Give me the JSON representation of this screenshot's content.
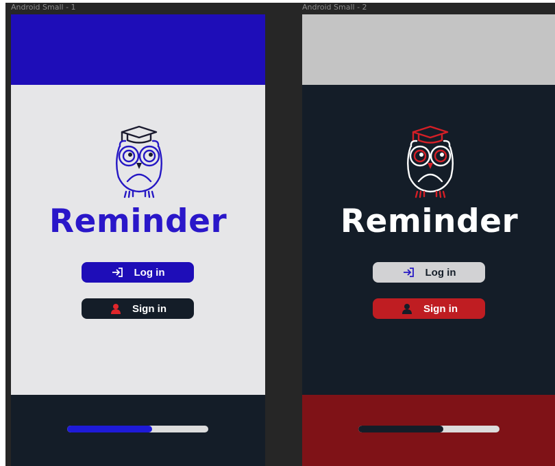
{
  "frames": [
    {
      "label": "Android Small - 1",
      "title": "Reminder",
      "login_label": "Log in",
      "signin_label": "Sign in",
      "progress": 0.6,
      "colors": {
        "top_bar": "#1e0db8",
        "body": "#e6e6e8",
        "bottom_bar": "#141d28",
        "title": "#2a17c9",
        "owl_primary": "#2517c4",
        "owl_accent": "#1a1a2e",
        "login_bg": "#1e0db8",
        "login_text": "#ffffff",
        "signin_bg": "#141d28",
        "signin_text": "#ffffff",
        "signin_icon": "#e0262b",
        "progress_fill": "#1e1ad8",
        "progress_track": "#dcdcdc"
      }
    },
    {
      "label": "Android Small - 2",
      "title": "Reminder",
      "login_label": "Log in",
      "signin_label": "Sign in",
      "progress": 0.6,
      "colors": {
        "top_bar": "#c4c4c4",
        "body": "#141d28",
        "bottom_bar": "#7f1217",
        "title": "#ffffff",
        "owl_primary": "#ffffff",
        "owl_accent": "#d51f26",
        "login_bg": "#d2d2d4",
        "login_text": "#141d28",
        "signin_bg": "#bf1d22",
        "signin_text": "#ffffff",
        "signin_icon": "#141d28",
        "progress_fill": "#141d28",
        "progress_track": "#dcdcdc"
      }
    }
  ],
  "icons": {
    "login": "login-arrow-icon",
    "signin": "user-icon",
    "logo": "owl-graduate-logo"
  }
}
